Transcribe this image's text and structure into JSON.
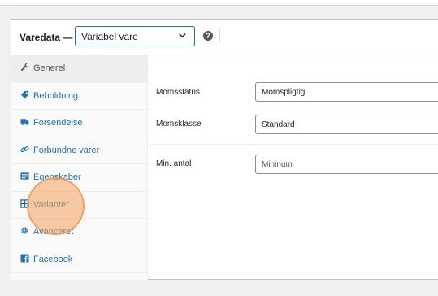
{
  "header": {
    "label": "Varedata —",
    "product_type": "Variabel vare",
    "help": "?"
  },
  "tabs": [
    {
      "label": "Generel",
      "icon": "wrench-icon",
      "active": true
    },
    {
      "label": "Beholdning",
      "icon": "tag-icon",
      "active": false
    },
    {
      "label": "Forsendelse",
      "icon": "truck-icon",
      "active": false
    },
    {
      "label": "Forbundne varer",
      "icon": "link-icon",
      "active": false
    },
    {
      "label": "Egenskaber",
      "icon": "list-icon",
      "active": false
    },
    {
      "label": "Varianter",
      "icon": "grid-icon",
      "active": false
    },
    {
      "label": "Avanceret",
      "icon": "gear-icon",
      "active": false
    },
    {
      "label": "Facebook",
      "icon": "facebook-icon",
      "active": false
    }
  ],
  "fields": {
    "tax_status": {
      "label": "Momsstatus",
      "value": "Momspligtig"
    },
    "tax_class": {
      "label": "Momsklasse",
      "value": "Standard"
    },
    "min_qty": {
      "label": "Min. antal",
      "placeholder": "Mininum"
    }
  },
  "colors": {
    "link": "#2271b1",
    "focus_border": "#2271b1",
    "click_highlight": "#f2a05a"
  }
}
